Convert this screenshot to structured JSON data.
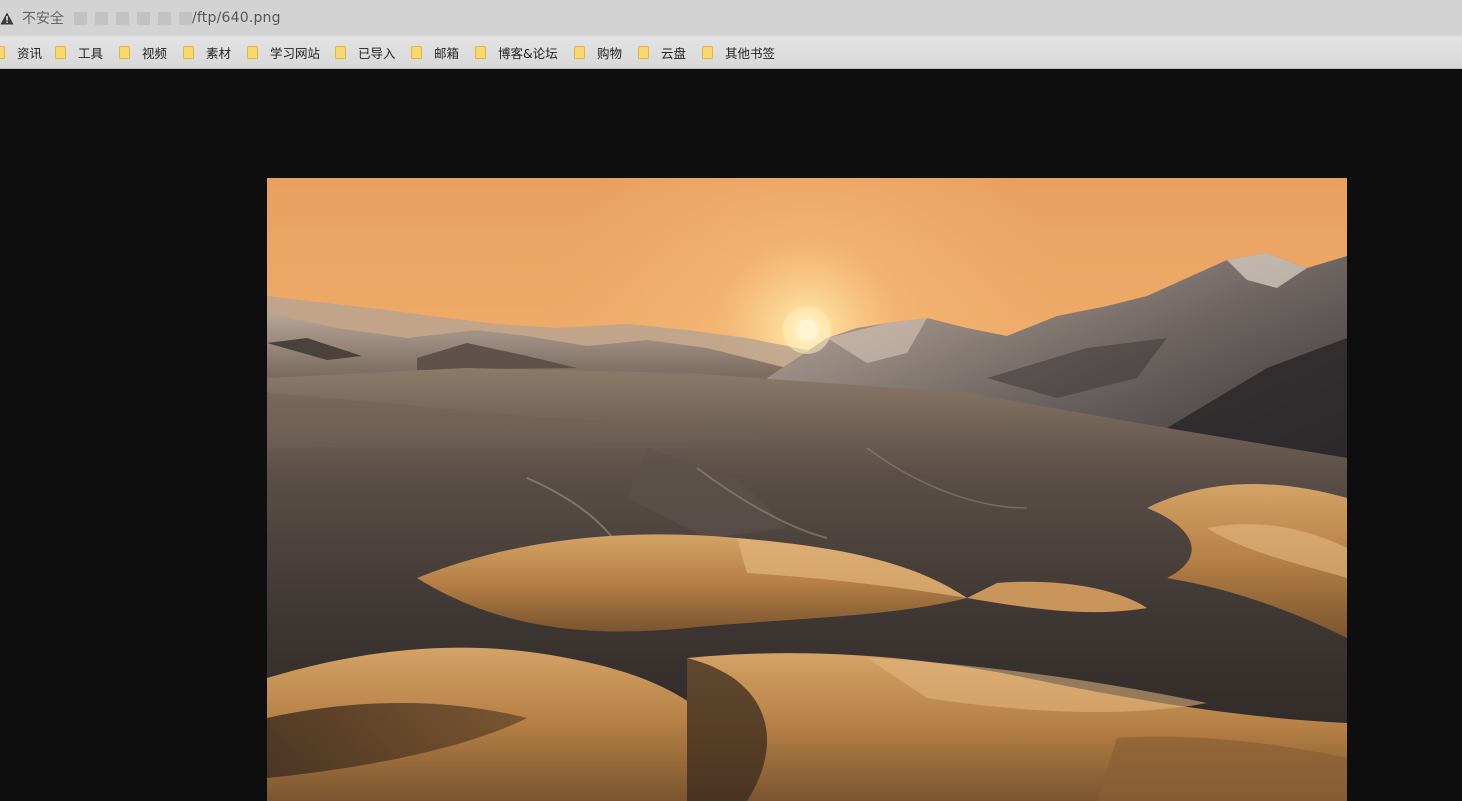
{
  "address_bar": {
    "security_label": "不安全",
    "url_path": "/ftp/640.png"
  },
  "bookmarks": [
    {
      "label": "资讯"
    },
    {
      "label": "工具"
    },
    {
      "label": "视频"
    },
    {
      "label": "素材"
    },
    {
      "label": "学习网站"
    },
    {
      "label": "已导入"
    },
    {
      "label": "邮箱"
    },
    {
      "label": "博客&论坛"
    },
    {
      "label": "购物"
    },
    {
      "label": "云盘"
    },
    {
      "label": "其他书签"
    }
  ],
  "colors": {
    "viewer_background": "#0e0e0e",
    "folder": "#f7d774",
    "sky_top": "#f0a85e",
    "sun": "#fff3c8",
    "sand": "#c28a4a"
  },
  "icons": {
    "security": "warning-triangle-icon",
    "bookmark": "folder-icon"
  }
}
